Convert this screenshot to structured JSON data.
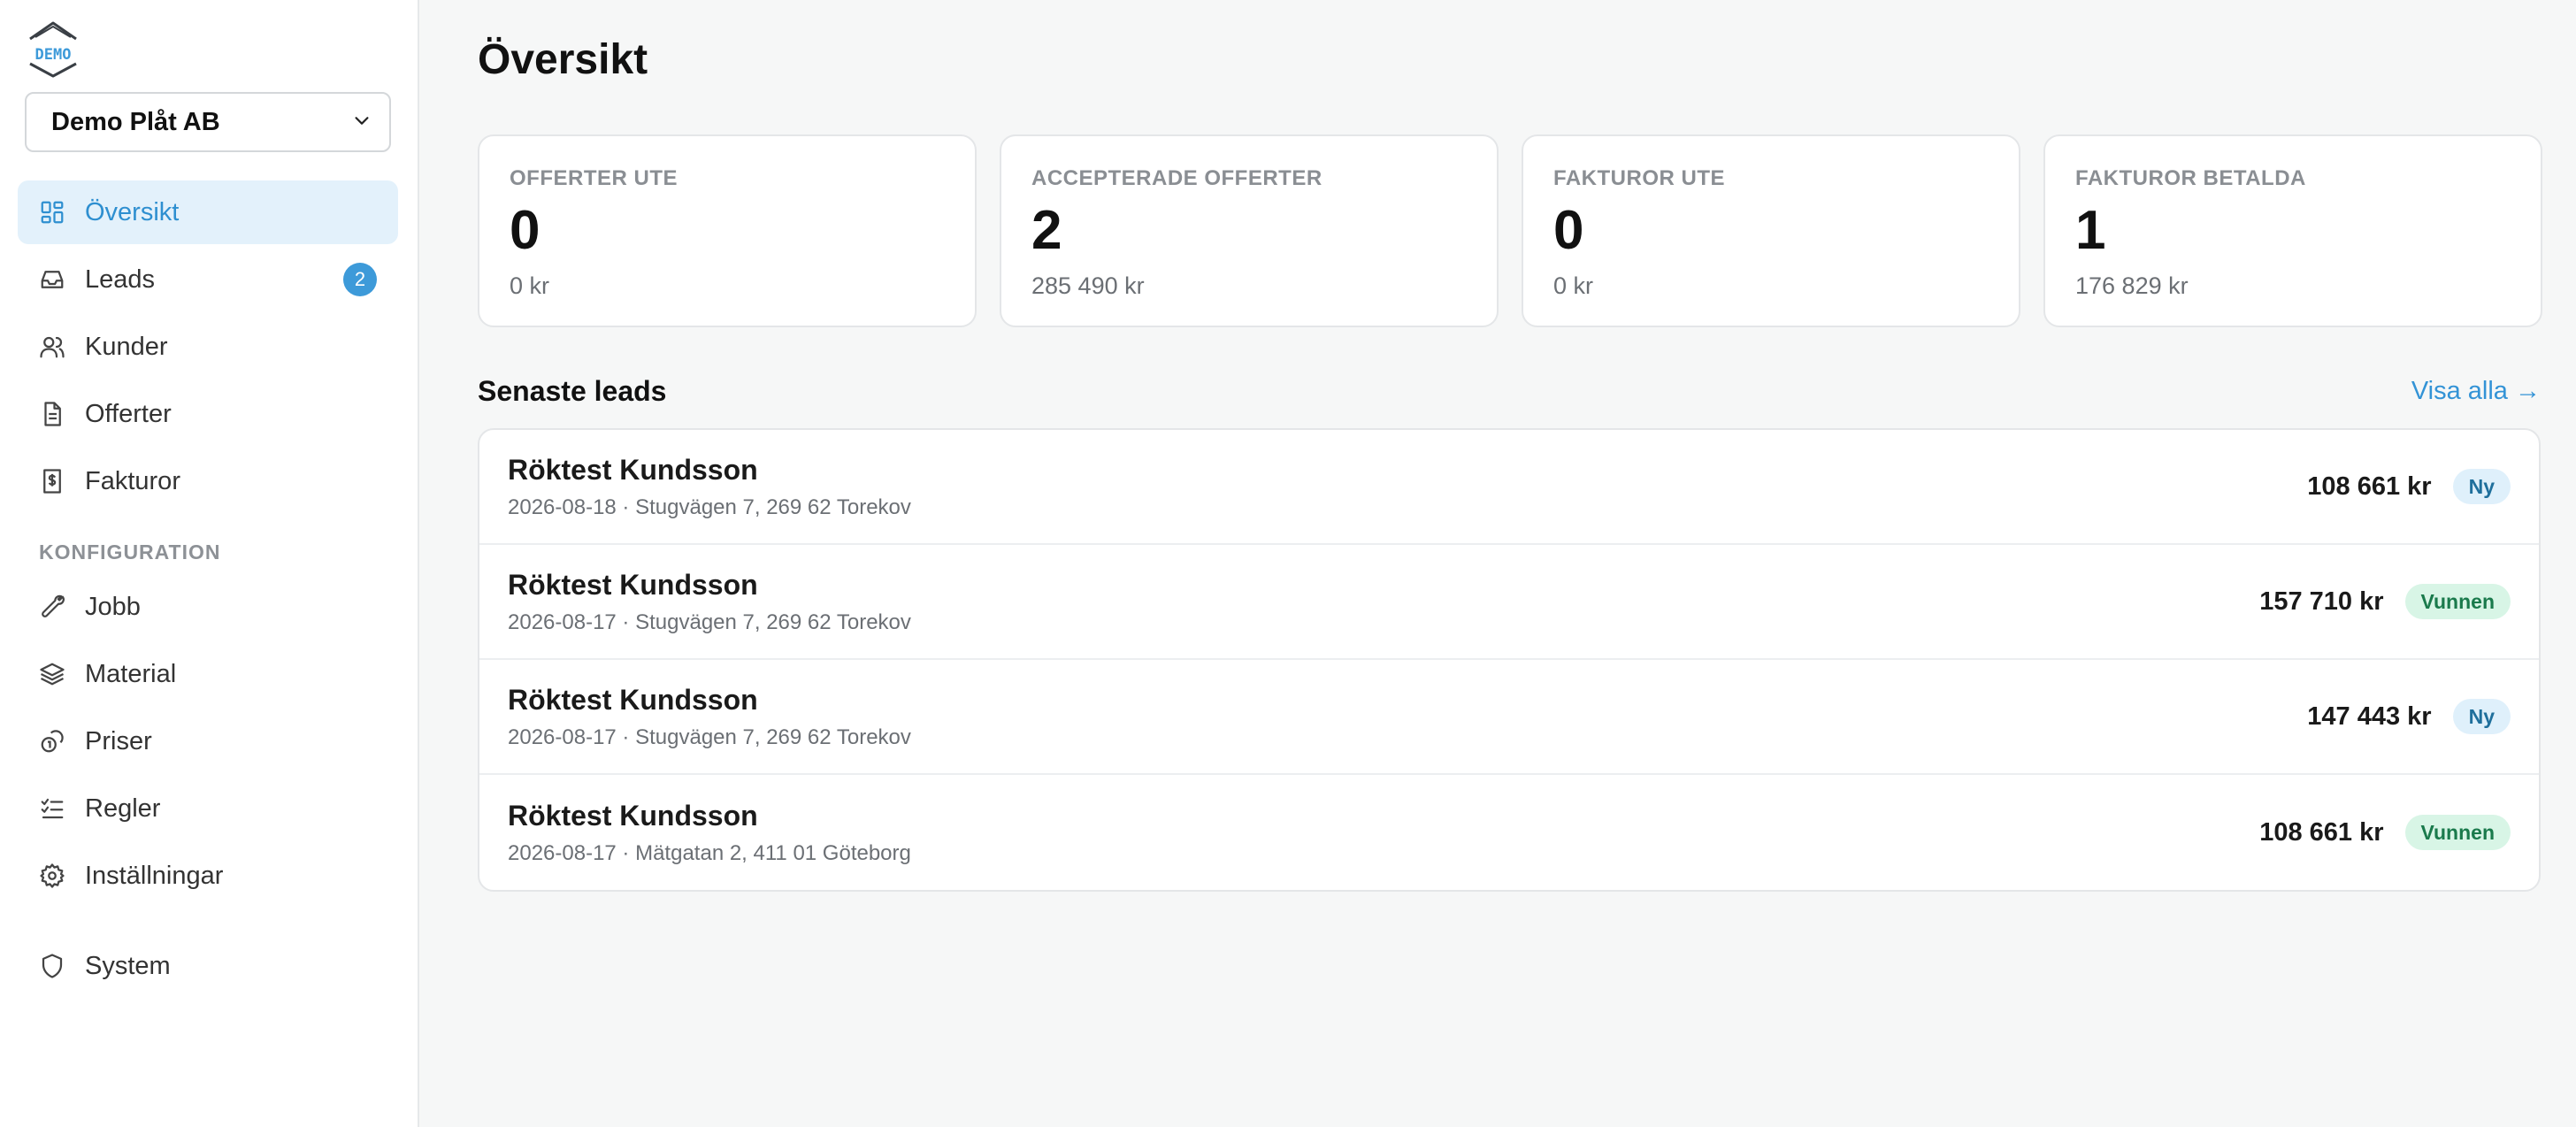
{
  "brand": {
    "logo_text": "DEMO"
  },
  "org_select": {
    "value": "Demo Plåt AB"
  },
  "nav": {
    "main": [
      {
        "label": "Översikt",
        "icon": "dashboard-icon",
        "active": true
      },
      {
        "label": "Leads",
        "icon": "inbox-icon",
        "badge": "2"
      },
      {
        "label": "Kunder",
        "icon": "users-icon"
      },
      {
        "label": "Offerter",
        "icon": "document-icon"
      },
      {
        "label": "Fakturor",
        "icon": "invoice-icon"
      }
    ],
    "config_label": "KONFIGURATION",
    "config": [
      {
        "label": "Jobb",
        "icon": "wrench-icon"
      },
      {
        "label": "Material",
        "icon": "layers-icon"
      },
      {
        "label": "Priser",
        "icon": "coins-icon"
      },
      {
        "label": "Regler",
        "icon": "checklist-icon"
      },
      {
        "label": "Inställningar",
        "icon": "gear-icon"
      }
    ],
    "system": {
      "label": "System",
      "icon": "shield-icon"
    }
  },
  "page": {
    "title": "Översikt"
  },
  "stats": [
    {
      "label": "OFFERTER UTE",
      "value": "0",
      "sub": "0 kr"
    },
    {
      "label": "ACCEPTERADE OFFERTER",
      "value": "2",
      "sub": "285 490 kr"
    },
    {
      "label": "FAKTUROR UTE",
      "value": "0",
      "sub": "0 kr"
    },
    {
      "label": "FAKTUROR BETALDA",
      "value": "1",
      "sub": "176 829 kr"
    }
  ],
  "leads": {
    "title": "Senaste leads",
    "view_all": "Visa alla →",
    "rows": [
      {
        "name": "Röktest Kundsson",
        "meta": "2026-08-18 · Stugvägen 7, 269 62 Torekov",
        "amount": "108 661 kr",
        "status": "Ny",
        "status_kind": "ny"
      },
      {
        "name": "Röktest Kundsson",
        "meta": "2026-08-17 · Stugvägen 7, 269 62 Torekov",
        "amount": "157 710 kr",
        "status": "Vunnen",
        "status_kind": "vunnen"
      },
      {
        "name": "Röktest Kundsson",
        "meta": "2026-08-17 · Stugvägen 7, 269 62 Torekov",
        "amount": "147 443 kr",
        "status": "Ny",
        "status_kind": "ny"
      },
      {
        "name": "Röktest Kundsson",
        "meta": "2026-08-17 · Mätgatan 2, 411 01 Göteborg",
        "amount": "108 661 kr",
        "status": "Vunnen",
        "status_kind": "vunnen"
      }
    ]
  },
  "colors": {
    "accent": "#3393d6",
    "active_bg": "#e3f1fb",
    "badge": "#3d9ad9",
    "ny_bg": "#dff0fb",
    "vunnen_bg": "#d8f5e6"
  }
}
